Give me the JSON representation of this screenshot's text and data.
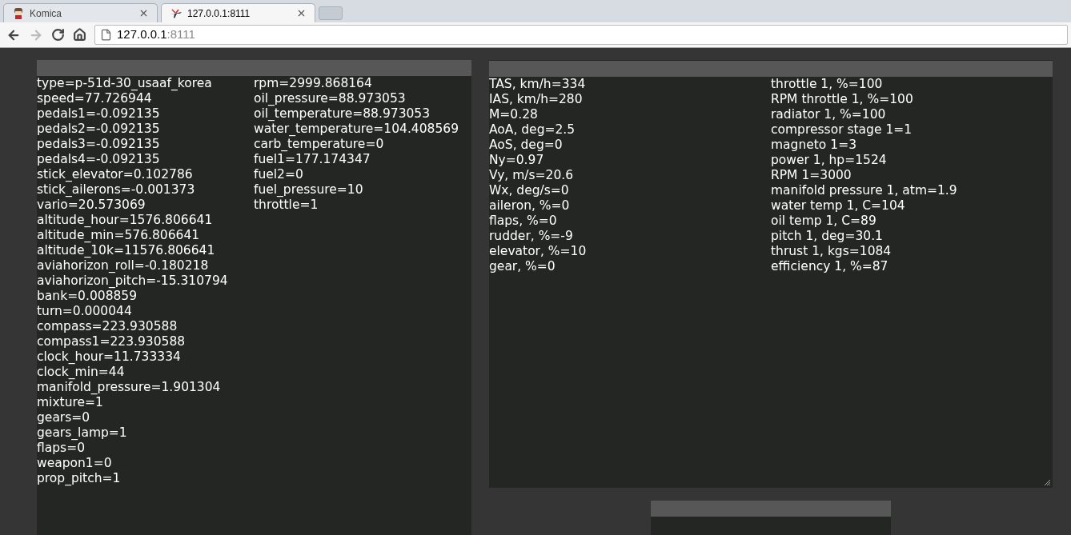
{
  "tabs": [
    {
      "title": "Komica",
      "selected": false
    },
    {
      "title": "127.0.0.1:8111",
      "selected": true
    }
  ],
  "address": {
    "host": "127.0.0.1",
    "port": ":8111"
  },
  "left_panel": {
    "columns": [
      [
        "type=p-51d-30_usaaf_korea",
        "speed=77.726944",
        "pedals1=-0.092135",
        "pedals2=-0.092135",
        "pedals3=-0.092135",
        "pedals4=-0.092135",
        "stick_elevator=0.102786",
        "stick_ailerons=-0.001373",
        "vario=20.573069",
        "altitude_hour=1576.806641",
        "altitude_min=576.806641",
        "altitude_10k=11576.806641",
        "aviahorizon_roll=-0.180218",
        "aviahorizon_pitch=-15.310794",
        "bank=0.008859",
        "turn=0.000044",
        "compass=223.930588",
        "compass1=223.930588",
        "clock_hour=11.733334",
        "clock_min=44",
        "manifold_pressure=1.901304",
        "mixture=1",
        "gears=0",
        "gears_lamp=1",
        "flaps=0",
        "weapon1=0",
        "prop_pitch=1"
      ],
      [
        "rpm=2999.868164",
        "oil_pressure=88.973053",
        "oil_temperature=88.973053",
        "water_temperature=104.408569",
        "carb_temperature=0",
        "fuel1=177.174347",
        "fuel2=0",
        "fuel_pressure=10",
        "throttle=1"
      ]
    ]
  },
  "right_panel": {
    "columns": [
      [
        "TAS, km/h=334",
        "IAS, km/h=280",
        "M=0.28",
        "AoA, deg=2.5",
        "AoS, deg=0",
        "Ny=0.97",
        "Vy, m/s=20.6",
        "Wx, deg/s=0",
        "aileron, %=0",
        "flaps, %=0",
        "rudder, %=-9",
        "elevator, %=10",
        "gear, %=0"
      ],
      [
        "throttle 1, %=100",
        "RPM throttle 1, %=100",
        "radiator 1, %=100",
        "compressor stage 1=1",
        "magneto 1=3",
        "power 1, hp=1524",
        "RPM 1=3000",
        "manifold pressure 1, atm=1.9",
        "water temp 1, C=104",
        "oil temp 1, C=89",
        "pitch 1, deg=30.1",
        "thrust 1, kgs=1084",
        "efficiency 1, %=87"
      ]
    ]
  }
}
